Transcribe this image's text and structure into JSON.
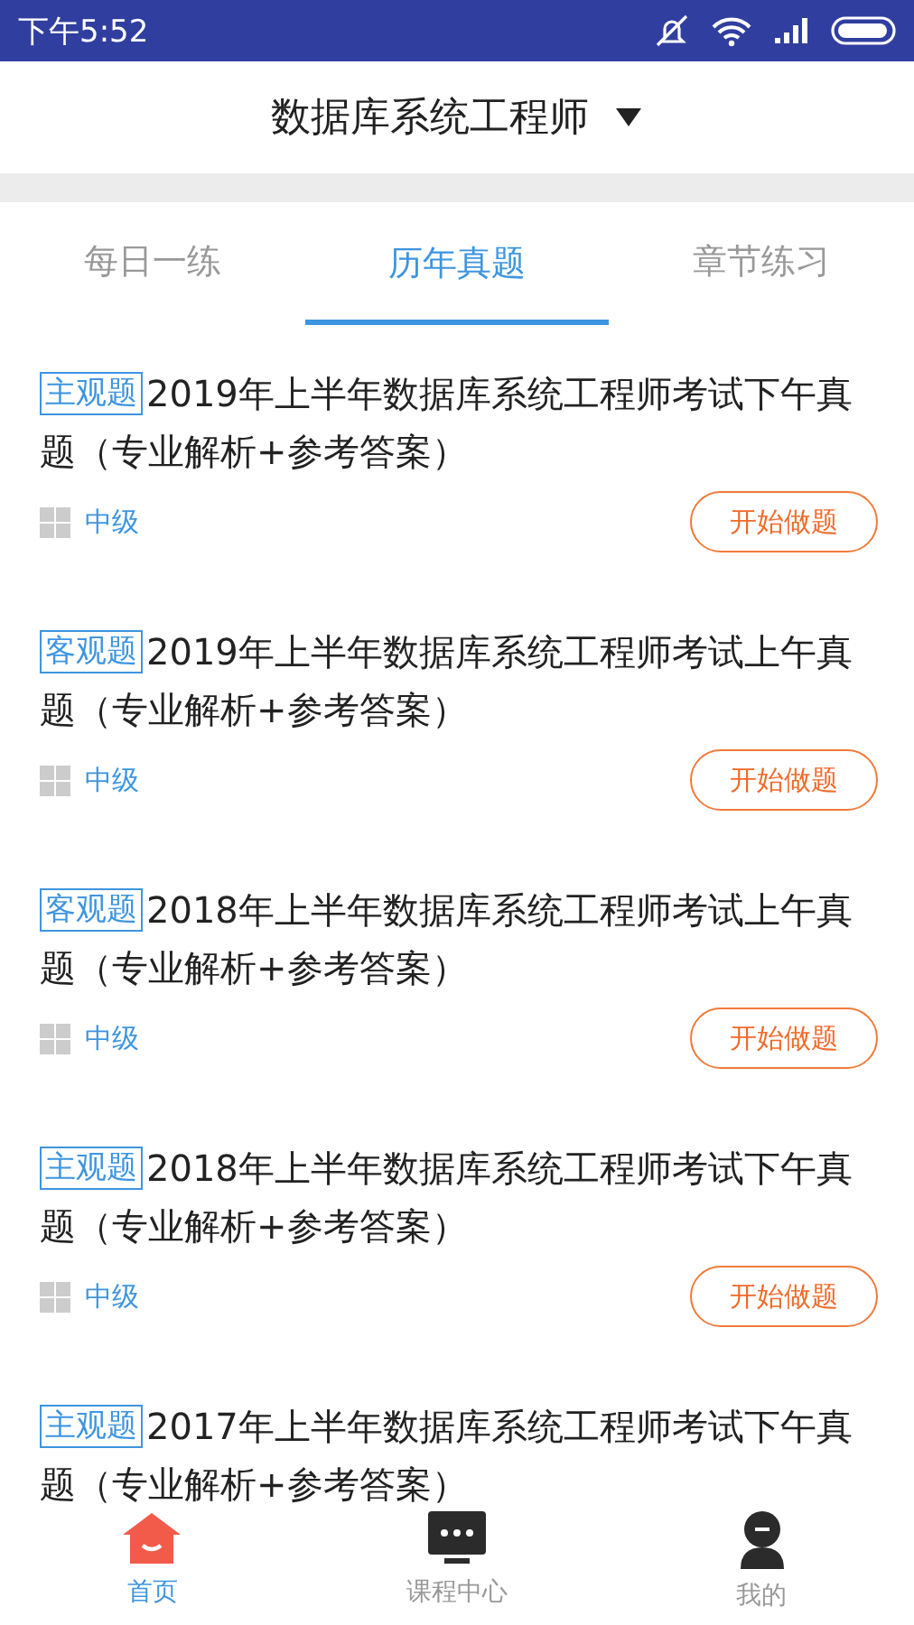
{
  "status_bar": {
    "time": "下午5:52"
  },
  "header": {
    "title": "数据库系统工程师"
  },
  "tabs": [
    {
      "label": "每日一练",
      "selected": false
    },
    {
      "label": "历年真题",
      "selected": true
    },
    {
      "label": "章节练习",
      "selected": false
    }
  ],
  "items": [
    {
      "tag": "主观题",
      "title": "2019年上半年数据库系统工程师考试下午真题（专业解析+参考答案）",
      "level": "中级",
      "action": "开始做题"
    },
    {
      "tag": "客观题",
      "title": "2019年上半年数据库系统工程师考试上午真题（专业解析+参考答案）",
      "level": "中级",
      "action": "开始做题"
    },
    {
      "tag": "客观题",
      "title": "2018年上半年数据库系统工程师考试上午真题（专业解析+参考答案）",
      "level": "中级",
      "action": "开始做题"
    },
    {
      "tag": "主观题",
      "title": "2018年上半年数据库系统工程师考试下午真题（专业解析+参考答案）",
      "level": "中级",
      "action": "开始做题"
    },
    {
      "tag": "主观题",
      "title": "2017年上半年数据库系统工程师考试下午真题（专业解析+参考答案）"
    }
  ],
  "bottom_nav": [
    {
      "label": "首页",
      "kind": "home",
      "selected": true
    },
    {
      "label": "课程中心",
      "kind": "courses",
      "selected": false
    },
    {
      "label": "我的",
      "kind": "profile",
      "selected": false
    }
  ]
}
